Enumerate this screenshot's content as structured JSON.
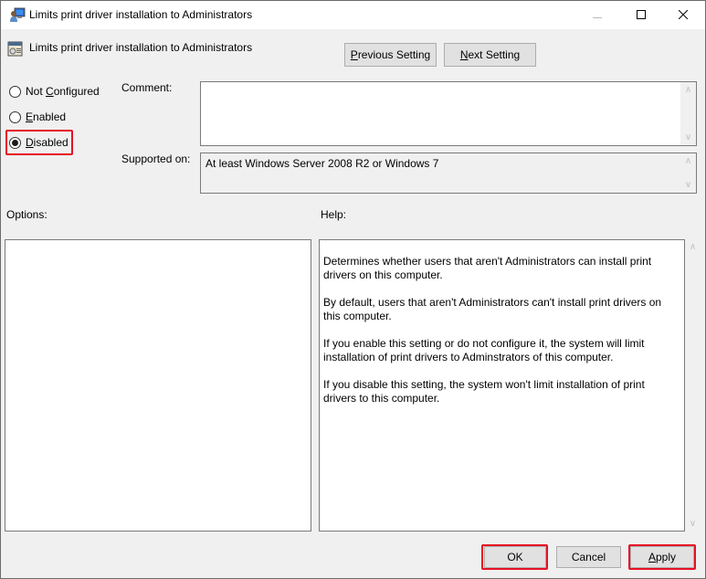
{
  "window": {
    "title": "Limits print driver installation to Administrators",
    "title_icon": "policy-computer-icon",
    "controls": {
      "minimize": "minimize-icon",
      "maximize": "maximize-icon",
      "close": "close-icon"
    }
  },
  "header": {
    "setting_name": "Limits print driver installation to Administrators",
    "setting_icon": "policy-setting-icon",
    "previous_button": {
      "prefix": "",
      "accel": "P",
      "rest": "revious Setting"
    },
    "next_button": {
      "prefix": "",
      "accel": "N",
      "rest": "ext Setting"
    }
  },
  "state": {
    "options": [
      {
        "prefix": "Not ",
        "accel": "C",
        "rest": "onfigured",
        "checked": false
      },
      {
        "prefix": "",
        "accel": "E",
        "rest": "nabled",
        "checked": false
      },
      {
        "prefix": "",
        "accel": "D",
        "rest": "isabled",
        "checked": true
      }
    ],
    "selected": "Disabled"
  },
  "comment": {
    "label": "Comment:",
    "value": ""
  },
  "supported_on": {
    "label": "Supported on:",
    "value": "At least Windows Server 2008 R2 or Windows 7"
  },
  "options_panel": {
    "label": "Options:"
  },
  "help_panel": {
    "label": "Help:",
    "paragraphs": [
      "Determines whether users that aren't Administrators can install print drivers on this computer.",
      "By default, users that aren't Administrators can't install print drivers on this computer.",
      "If you enable this setting or do not configure it, the system will limit installation of print drivers to Adminstrators of this computer.",
      "If you disable this setting, the system won't limit installation of print drivers to this computer."
    ]
  },
  "footer": {
    "ok": "OK",
    "cancel": "Cancel",
    "apply": {
      "prefix": "",
      "accel": "A",
      "rest": "pply"
    }
  },
  "annotations": {
    "highlight_color": "#e81123",
    "highlighted": [
      "Disabled",
      "OK",
      "Apply"
    ]
  }
}
